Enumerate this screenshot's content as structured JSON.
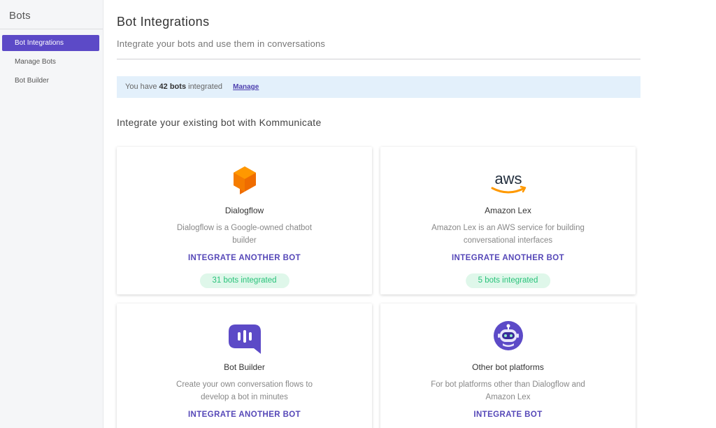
{
  "sidebar": {
    "title": "Bots",
    "items": [
      {
        "label": "Bot Integrations",
        "active": true
      },
      {
        "label": "Manage Bots",
        "active": false
      },
      {
        "label": "Bot Builder",
        "active": false
      }
    ]
  },
  "header": {
    "title": "Bot Integrations",
    "subtitle": "Integrate your bots and use them in conversations"
  },
  "banner": {
    "prefix": "You have",
    "count": "42 bots",
    "suffix": "integrated",
    "link": "Manage"
  },
  "section": {
    "title": "Integrate your existing bot with Kommunicate"
  },
  "cards": [
    {
      "icon": "dialogflow-icon",
      "name": "Dialogflow",
      "description": "Dialogflow is a Google-owned chatbot builder",
      "action": "INTEGRATE ANOTHER BOT",
      "badge": "31 bots integrated"
    },
    {
      "icon": "aws-icon",
      "name": "Amazon Lex",
      "description": "Amazon Lex is an AWS service for building conversational interfaces",
      "action": "INTEGRATE ANOTHER BOT",
      "badge": "5 bots integrated"
    },
    {
      "icon": "bot-builder-icon",
      "name": "Bot Builder",
      "description": "Create your own conversation flows to develop a bot in minutes",
      "action": "INTEGRATE ANOTHER BOT"
    },
    {
      "icon": "robot-icon",
      "name": "Other bot platforms",
      "description": "For bot platforms other than Dialogflow and Amazon Lex",
      "action": "INTEGRATE BOT"
    }
  ],
  "aws_text": "aws",
  "colors": {
    "accent": "#5c4ac7",
    "link": "#5648b8",
    "banner_bg": "#e3f0fb",
    "badge_bg": "#dff7ea",
    "badge_text": "#29c27a",
    "dialogflow_orange": "#f57c00",
    "aws_orange": "#ff9900"
  }
}
